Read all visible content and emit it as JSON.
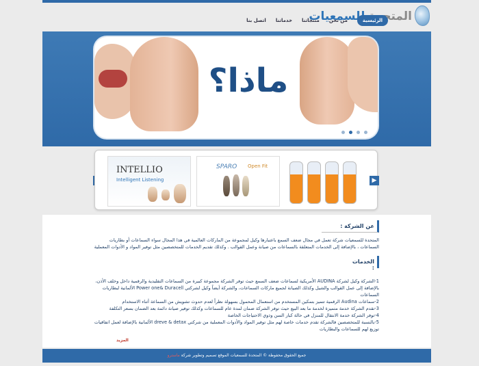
{
  "logo": {
    "part1": "المتحدة",
    "part2": "للسمعيات"
  },
  "nav": [
    {
      "label": "الرئيسية",
      "active": true
    },
    {
      "label": "من نحن",
      "active": false
    },
    {
      "label": "منتجاتنا",
      "active": false
    },
    {
      "label": "خدماتنا",
      "active": false
    },
    {
      "label": "اتصل بنا",
      "active": false
    }
  ],
  "banner": {
    "title": "ماذا؟",
    "slides": 4,
    "current": 2
  },
  "products": [
    {
      "brand": "INTELLIO",
      "tagline": "Intelligent Listening"
    },
    {
      "brand": "SPARO",
      "tagline": "Open Fit"
    },
    {
      "brand": "",
      "tagline": ""
    }
  ],
  "about": {
    "heading": "عن الشركة :",
    "text": "المتحدة للسمعيات شركة تعمل في مجال ضعف السمع باعتبارها وكيل لمجموعة من الماركات العالمية في هذا المجال سواء السماعات أو بطاريات السماعات ، بالإضافة إلى الخدمات المتعلقة بالسماعات من صيانة وعمل القوالب . وكذلك تقديم الخدمات للمتخصصين مثل توفير المواد و الأدوات المعملية"
  },
  "services": {
    "heading": "الخدمات :",
    "items": [
      "1-الشركة وكيل لشركة AUDINA الأمريكية لسماعات ضعف السمع حيث توفر الشركة مجموعة كبيرة من السماعات التقليدية والرقمية داخل وخلف الأذن، بالإضافة إلى عمل القوالب والشيل وكذلك الصيانة لجميع ماركات السماعات، والشركة أيضاً وكيل لشركتي Power one& Duracell الألمانية لبطاريات السماعات",
      "2-سماعات Audina الرقمية تتميز بتمكين المستخدم من استعمال المحمول بسهولة نظراً لعدم حدوث تشويش من السماعة أثناء الاستخدام",
      "3-تقدم الشركة خدمة متميزة لخدمة ما بعد البيع حيث توفر الشركة ضمان لمدة عام للسماعات وكذلك توفير صيانة دائمة بعد الضمان بسعر التكلفة",
      "4-توفر الشركة خدمة الانتقال للمنزل في حالة كبار السن وذوي الاحتياجات الخاصة",
      "5-بالنسبة للمتخصصين فالشركة تقدم خدمات خاصة لهم مثل توفير المواد والأدوات المعملية من شركتي dreve & detax الألمانية بالإضافة لعمل اتفاقيات توزيع لهم للسماعات والبطاريات"
    ],
    "more_label": "المزيد"
  },
  "footer": {
    "text": "جميع الحقوق محفوظة © المتحدة للسمعيات الموقع",
    "credit": "تصميم وتطوير شركة",
    "company": "ماسترو"
  },
  "colors": {
    "primary": "#2f6aa8",
    "accent": "#e45c5c"
  }
}
